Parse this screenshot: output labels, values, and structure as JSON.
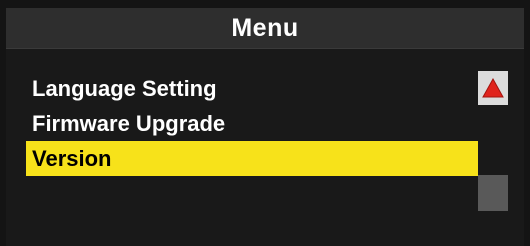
{
  "header": {
    "title": "Menu"
  },
  "menu": {
    "items": [
      {
        "label": "Language Setting",
        "selected": false
      },
      {
        "label": "Firmware Upgrade",
        "selected": false
      },
      {
        "label": "Version",
        "selected": true
      }
    ]
  },
  "scrollbar": {
    "up_icon": "triangle-up-icon",
    "up_icon_color": "#e0231c",
    "thumb_color": "#595959"
  },
  "colors": {
    "highlight": "#f7e21a",
    "text": "#ffffff",
    "title_bar": "#2e2e2e"
  }
}
